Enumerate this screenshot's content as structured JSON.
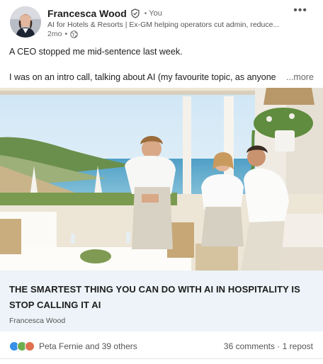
{
  "author": {
    "name": "Francesca Wood",
    "relation": "You",
    "headline": "AI for Hotels & Resorts | Ex-GM helping operators cut admin, reduce...",
    "time": "2mo"
  },
  "post": {
    "line1": "A CEO stopped me mid-sentence last week.",
    "line2": "I was on an intro call, talking about AI (my favourite topic, as anyone",
    "see_more": "...more"
  },
  "article": {
    "title": "THE SMARTEST THING YOU CAN DO WITH AI IN HOSPITALITY IS STOP CALLING IT AI",
    "author": "Francesca Wood"
  },
  "social": {
    "reactors": "Peta Fernie and 39 others",
    "comments": "36 comments",
    "separator": "·",
    "reposts": "1 repost"
  },
  "icons": {
    "menu": "more-horizontal-icon",
    "verified": "verified-shield-icon",
    "visibility": "globe-icon",
    "reactions": [
      "like-icon",
      "celebrate-icon",
      "love-icon"
    ]
  },
  "colors": {
    "like": "#378fe9",
    "celebrate": "#6dae4f",
    "love": "#df704d",
    "article_bg": "#edf3f8"
  }
}
